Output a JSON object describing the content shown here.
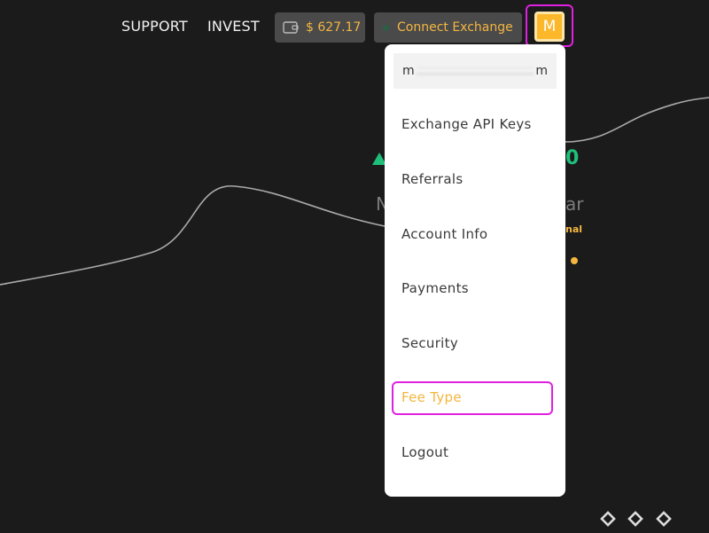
{
  "header": {
    "nav": [
      "SUPPORT",
      "INVEST"
    ],
    "balance": "$ 627.17",
    "connect_label": "Connect Exchange",
    "avatar_letter": "M"
  },
  "menu": {
    "email_start": "m",
    "email_end": "m",
    "items": [
      "Exchange API Keys",
      "Referrals",
      "Account Info",
      "Payments",
      "Security",
      "Fee Type",
      "Logout"
    ],
    "active": "Fee Type"
  },
  "background": {
    "left_text": "N",
    "right_text": "ar",
    "value_fragment": "0",
    "tag_fragment": "nal"
  },
  "colors": {
    "accent": "#f4b63f",
    "highlight": "#e020e0",
    "positive": "#1fbf7a"
  }
}
